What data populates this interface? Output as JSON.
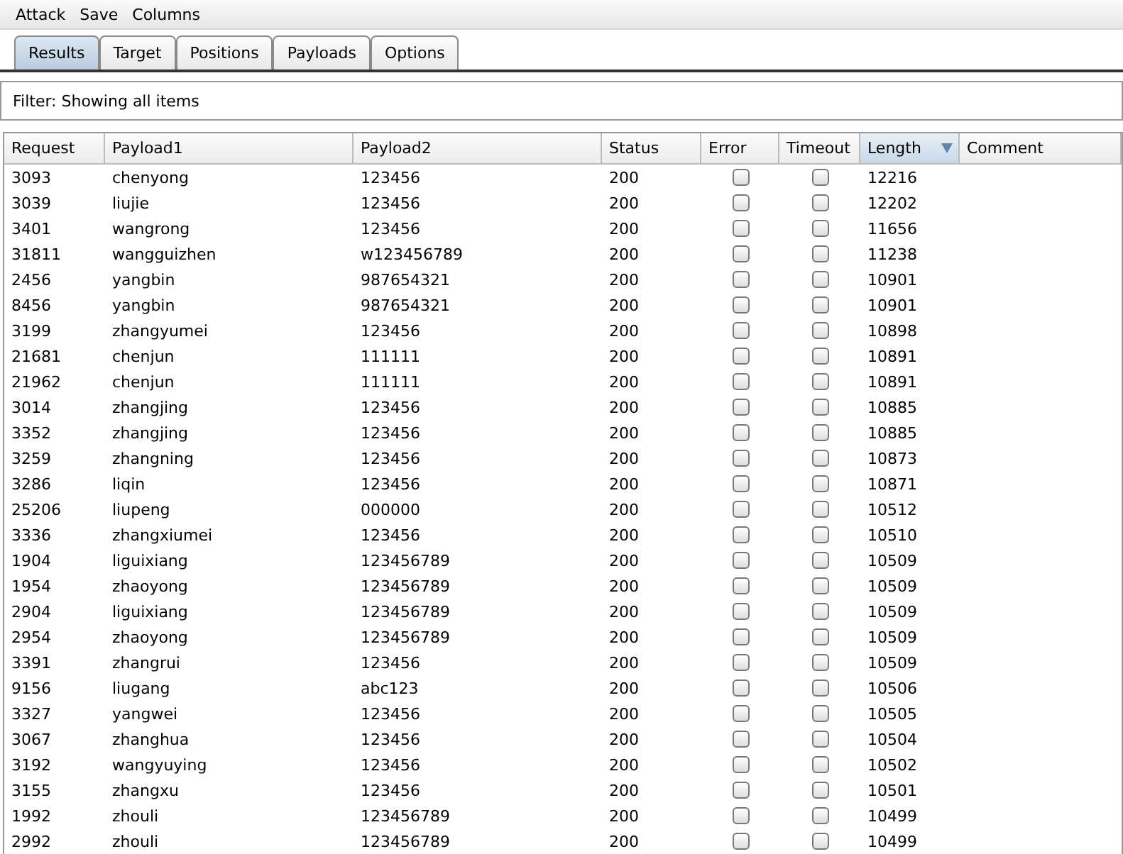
{
  "menu": [
    "Attack",
    "Save",
    "Columns"
  ],
  "tabs": [
    {
      "label": "Results",
      "selected": true
    },
    {
      "label": "Target",
      "selected": false
    },
    {
      "label": "Positions",
      "selected": false
    },
    {
      "label": "Payloads",
      "selected": false
    },
    {
      "label": "Options",
      "selected": false
    }
  ],
  "filter": "Filter:  Showing all items",
  "table": {
    "columns": [
      {
        "label": "Request",
        "sorted": false
      },
      {
        "label": "Payload1",
        "sorted": false
      },
      {
        "label": "Payload2",
        "sorted": false
      },
      {
        "label": "Status",
        "sorted": false
      },
      {
        "label": "Error",
        "sorted": false
      },
      {
        "label": "Timeout",
        "sorted": false
      },
      {
        "label": "Length",
        "sorted": true
      },
      {
        "label": "Comment",
        "sorted": false
      }
    ],
    "rows": [
      {
        "request": "3093",
        "payload1": "chenyong",
        "payload2": "123456",
        "status": "200",
        "error": false,
        "timeout": false,
        "length": "12216"
      },
      {
        "request": "3039",
        "payload1": "liujie",
        "payload2": "123456",
        "status": "200",
        "error": false,
        "timeout": false,
        "length": "12202"
      },
      {
        "request": "3401",
        "payload1": "wangrong",
        "payload2": "123456",
        "status": "200",
        "error": false,
        "timeout": false,
        "length": "11656"
      },
      {
        "request": "31811",
        "payload1": "wangguizhen",
        "payload2": "w123456789",
        "status": "200",
        "error": false,
        "timeout": false,
        "length": "11238"
      },
      {
        "request": "2456",
        "payload1": "yangbin",
        "payload2": "987654321",
        "status": "200",
        "error": false,
        "timeout": false,
        "length": "10901"
      },
      {
        "request": "8456",
        "payload1": "yangbin",
        "payload2": "987654321",
        "status": "200",
        "error": false,
        "timeout": false,
        "length": "10901"
      },
      {
        "request": "3199",
        "payload1": "zhangyumei",
        "payload2": "123456",
        "status": "200",
        "error": false,
        "timeout": false,
        "length": "10898"
      },
      {
        "request": "21681",
        "payload1": "chenjun",
        "payload2": "111111",
        "status": "200",
        "error": false,
        "timeout": false,
        "length": "10891"
      },
      {
        "request": "21962",
        "payload1": "chenjun",
        "payload2": "111111",
        "status": "200",
        "error": false,
        "timeout": false,
        "length": "10891"
      },
      {
        "request": "3014",
        "payload1": "zhangjing",
        "payload2": "123456",
        "status": "200",
        "error": false,
        "timeout": false,
        "length": "10885"
      },
      {
        "request": "3352",
        "payload1": "zhangjing",
        "payload2": "123456",
        "status": "200",
        "error": false,
        "timeout": false,
        "length": "10885"
      },
      {
        "request": "3259",
        "payload1": "zhangning",
        "payload2": "123456",
        "status": "200",
        "error": false,
        "timeout": false,
        "length": "10873"
      },
      {
        "request": "3286",
        "payload1": "liqin",
        "payload2": "123456",
        "status": "200",
        "error": false,
        "timeout": false,
        "length": "10871"
      },
      {
        "request": "25206",
        "payload1": "liupeng",
        "payload2": "000000",
        "status": "200",
        "error": false,
        "timeout": false,
        "length": "10512"
      },
      {
        "request": "3336",
        "payload1": "zhangxiumei",
        "payload2": "123456",
        "status": "200",
        "error": false,
        "timeout": false,
        "length": "10510"
      },
      {
        "request": "1904",
        "payload1": "liguixiang",
        "payload2": "123456789",
        "status": "200",
        "error": false,
        "timeout": false,
        "length": "10509"
      },
      {
        "request": "1954",
        "payload1": "zhaoyong",
        "payload2": "123456789",
        "status": "200",
        "error": false,
        "timeout": false,
        "length": "10509"
      },
      {
        "request": "2904",
        "payload1": "liguixiang",
        "payload2": "123456789",
        "status": "200",
        "error": false,
        "timeout": false,
        "length": "10509"
      },
      {
        "request": "2954",
        "payload1": "zhaoyong",
        "payload2": "123456789",
        "status": "200",
        "error": false,
        "timeout": false,
        "length": "10509"
      },
      {
        "request": "3391",
        "payload1": "zhangrui",
        "payload2": "123456",
        "status": "200",
        "error": false,
        "timeout": false,
        "length": "10509"
      },
      {
        "request": "9156",
        "payload1": "liugang",
        "payload2": "abc123",
        "status": "200",
        "error": false,
        "timeout": false,
        "length": "10506"
      },
      {
        "request": "3327",
        "payload1": "yangwei",
        "payload2": "123456",
        "status": "200",
        "error": false,
        "timeout": false,
        "length": "10505"
      },
      {
        "request": "3067",
        "payload1": "zhanghua",
        "payload2": "123456",
        "status": "200",
        "error": false,
        "timeout": false,
        "length": "10504"
      },
      {
        "request": "3192",
        "payload1": "wangyuying",
        "payload2": "123456",
        "status": "200",
        "error": false,
        "timeout": false,
        "length": "10502"
      },
      {
        "request": "3155",
        "payload1": "zhangxu",
        "payload2": "123456",
        "status": "200",
        "error": false,
        "timeout": false,
        "length": "10501"
      },
      {
        "request": "1992",
        "payload1": "zhouli",
        "payload2": "123456789",
        "status": "200",
        "error": false,
        "timeout": false,
        "length": "10499"
      },
      {
        "request": "2992",
        "payload1": "zhouli",
        "payload2": "123456789",
        "status": "200",
        "error": false,
        "timeout": false,
        "length": "10499"
      }
    ]
  }
}
